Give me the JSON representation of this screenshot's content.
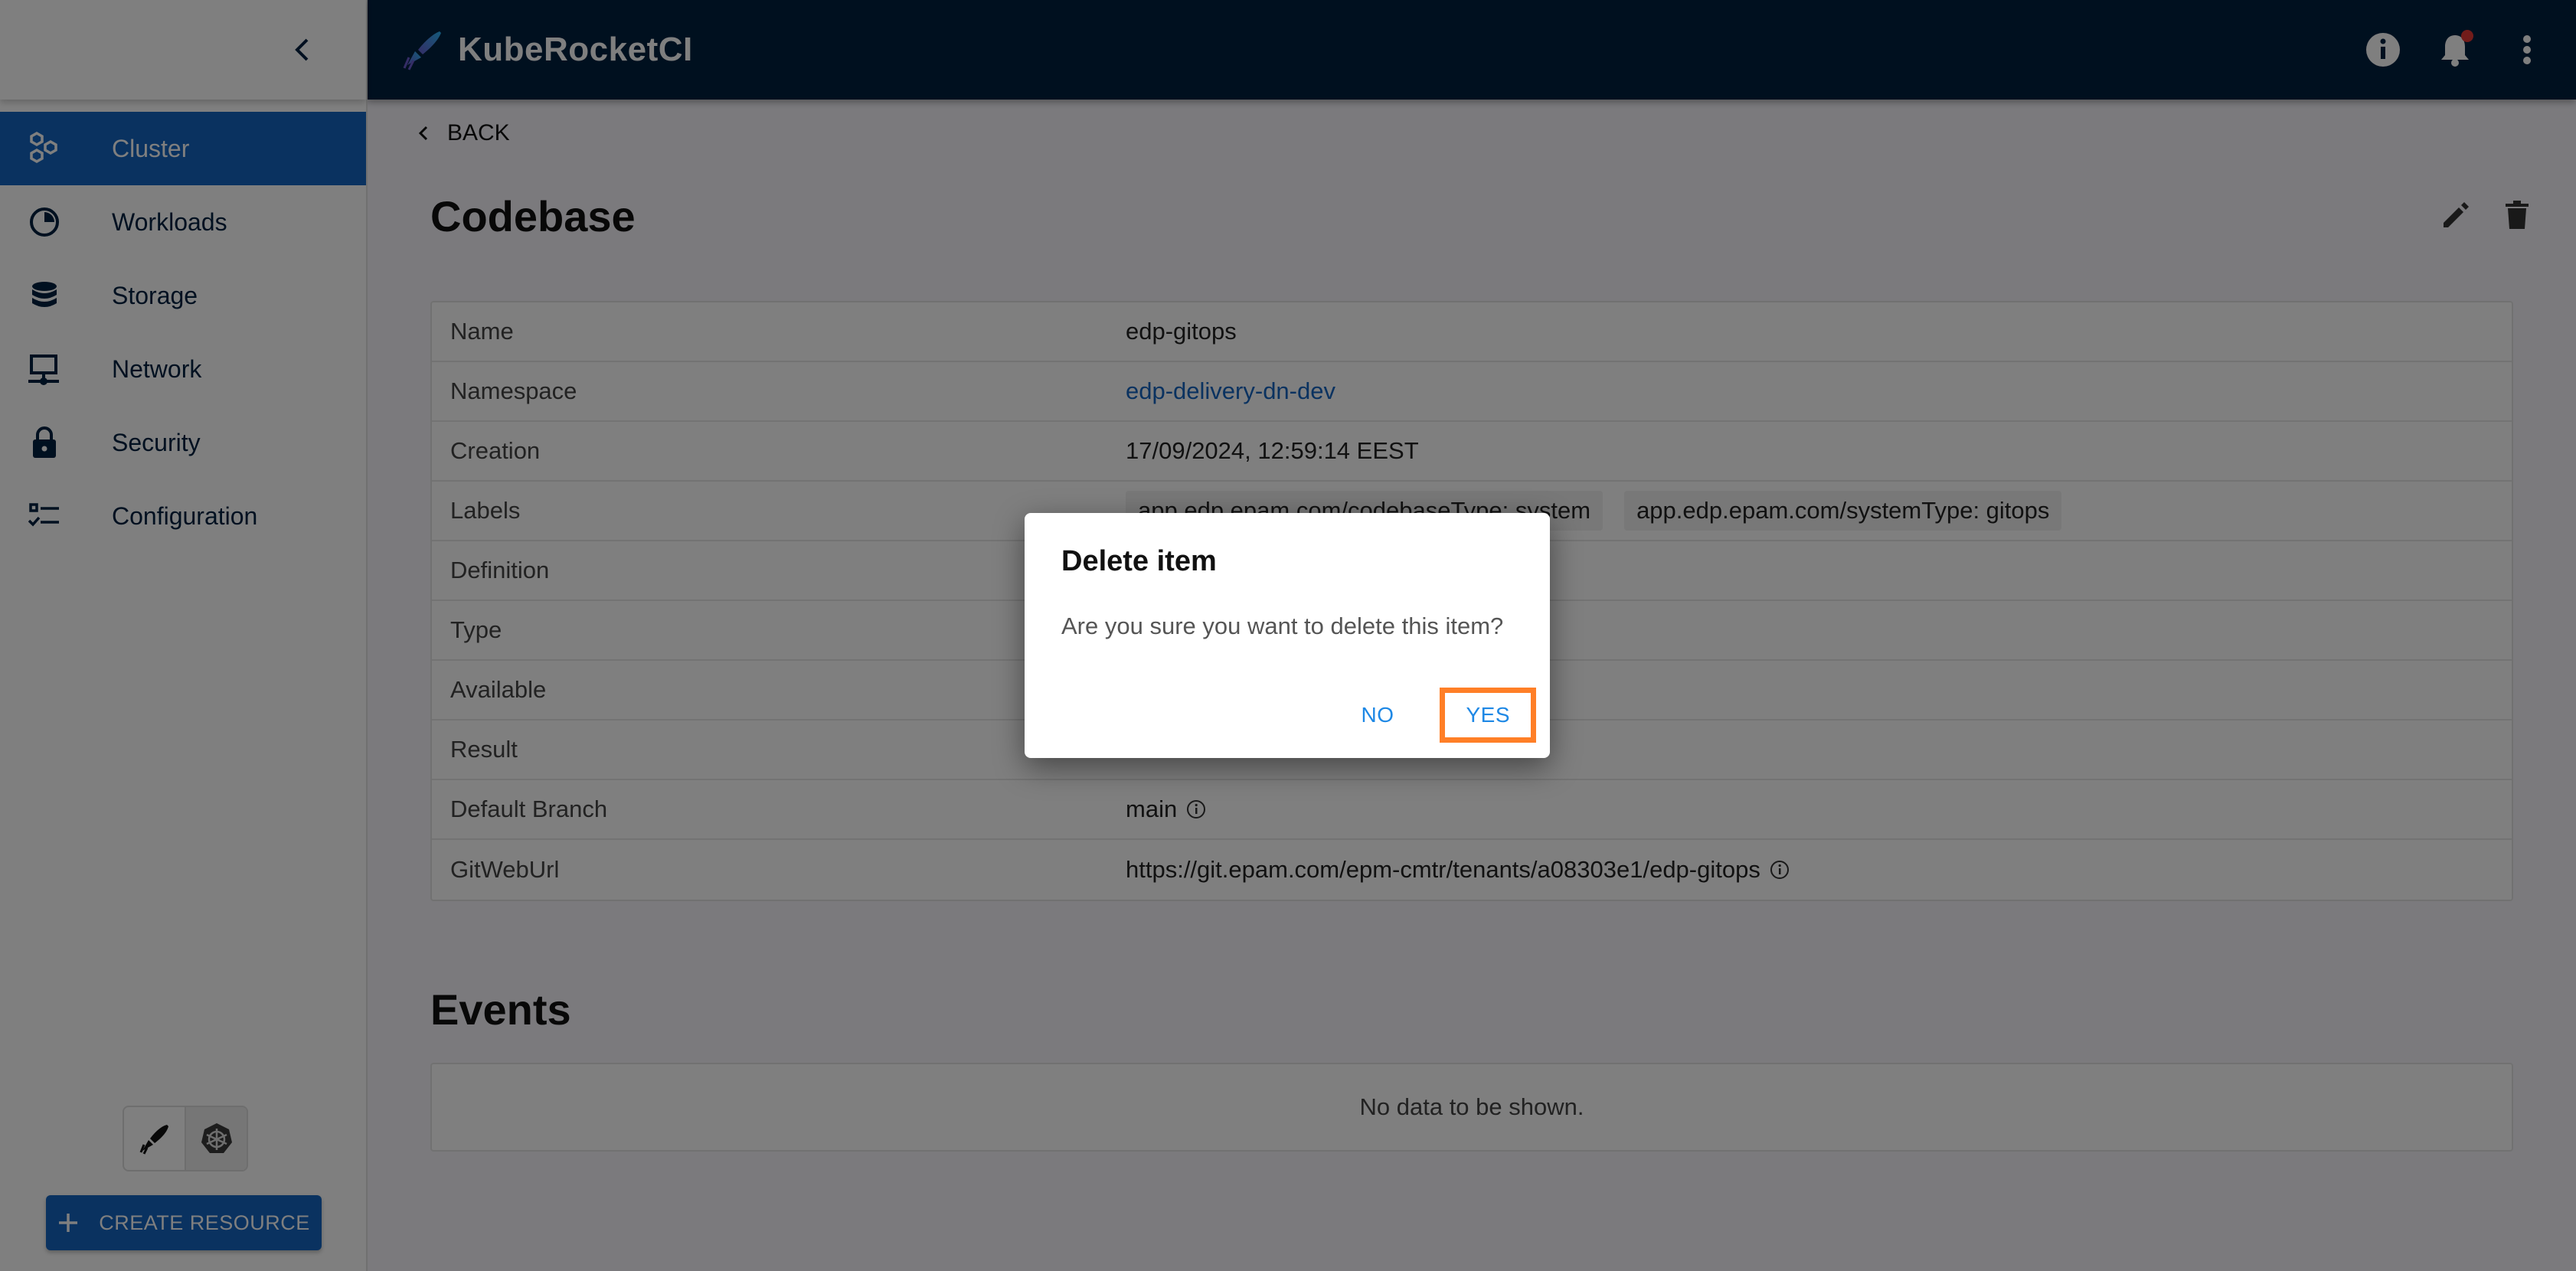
{
  "header": {
    "app_name": "KubeRocketCI",
    "actions": [
      {
        "icon": "info-icon"
      },
      {
        "icon": "notifications-bell-icon",
        "has_badge": true
      },
      {
        "icon": "more-vertical-icon"
      }
    ]
  },
  "sidebar": {
    "collapse_icon": "chevron-left-icon",
    "items": [
      {
        "label": "Cluster",
        "icon": "cluster-hexagons-icon",
        "active": true
      },
      {
        "label": "Workloads",
        "icon": "workloads-clock-icon",
        "active": false
      },
      {
        "label": "Storage",
        "icon": "storage-database-icon",
        "active": false
      },
      {
        "label": "Network",
        "icon": "network-computer-icon",
        "active": false
      },
      {
        "label": "Security",
        "icon": "security-lock-icon",
        "active": false
      },
      {
        "label": "Configuration",
        "icon": "configuration-checklist-icon",
        "active": false
      }
    ],
    "mode_toggle": [
      {
        "icon": "rocket-icon",
        "selected": false
      },
      {
        "icon": "kubernetes-icon",
        "selected": true
      }
    ],
    "create_button": {
      "label": "CREATE RESOURCE",
      "icon": "plus-icon"
    }
  },
  "main": {
    "back_label": "BACK",
    "title": "Codebase",
    "title_actions": [
      {
        "icon": "edit-pencil-icon"
      },
      {
        "icon": "delete-trash-icon"
      }
    ],
    "details": [
      {
        "label": "Name",
        "value": "edp-gitops"
      },
      {
        "label": "Namespace",
        "value": "edp-delivery-dn-dev",
        "link": true
      },
      {
        "label": "Creation",
        "value": "17/09/2024, 12:59:14 EEST"
      },
      {
        "label": "Labels",
        "chips": [
          "app.edp.epam.com/codebaseType: system",
          "app.edp.epam.com/systemType: gitops"
        ]
      },
      {
        "label": "Definition",
        "value": ""
      },
      {
        "label": "Type",
        "value": ""
      },
      {
        "label": "Available",
        "value": ""
      },
      {
        "label": "Result",
        "value": ""
      },
      {
        "label": "Default Branch",
        "value": "main",
        "info": true
      },
      {
        "label": "GitWebUrl",
        "value": "https://git.epam.com/epm-cmtr/tenants/a08303e1/edp-gitops",
        "info": true
      }
    ],
    "events_title": "Events",
    "events_empty": "No data to be shown."
  },
  "dialog": {
    "title": "Delete item",
    "message": "Are you sure you want to delete this item?",
    "no_label": "NO",
    "yes_label": "YES"
  },
  "colors": {
    "header_bg": "#00203f",
    "primary": "#1565c0",
    "dialog_button": "#1e88e5",
    "highlight": "#ff7f27",
    "notification_badge": "#e53935"
  }
}
